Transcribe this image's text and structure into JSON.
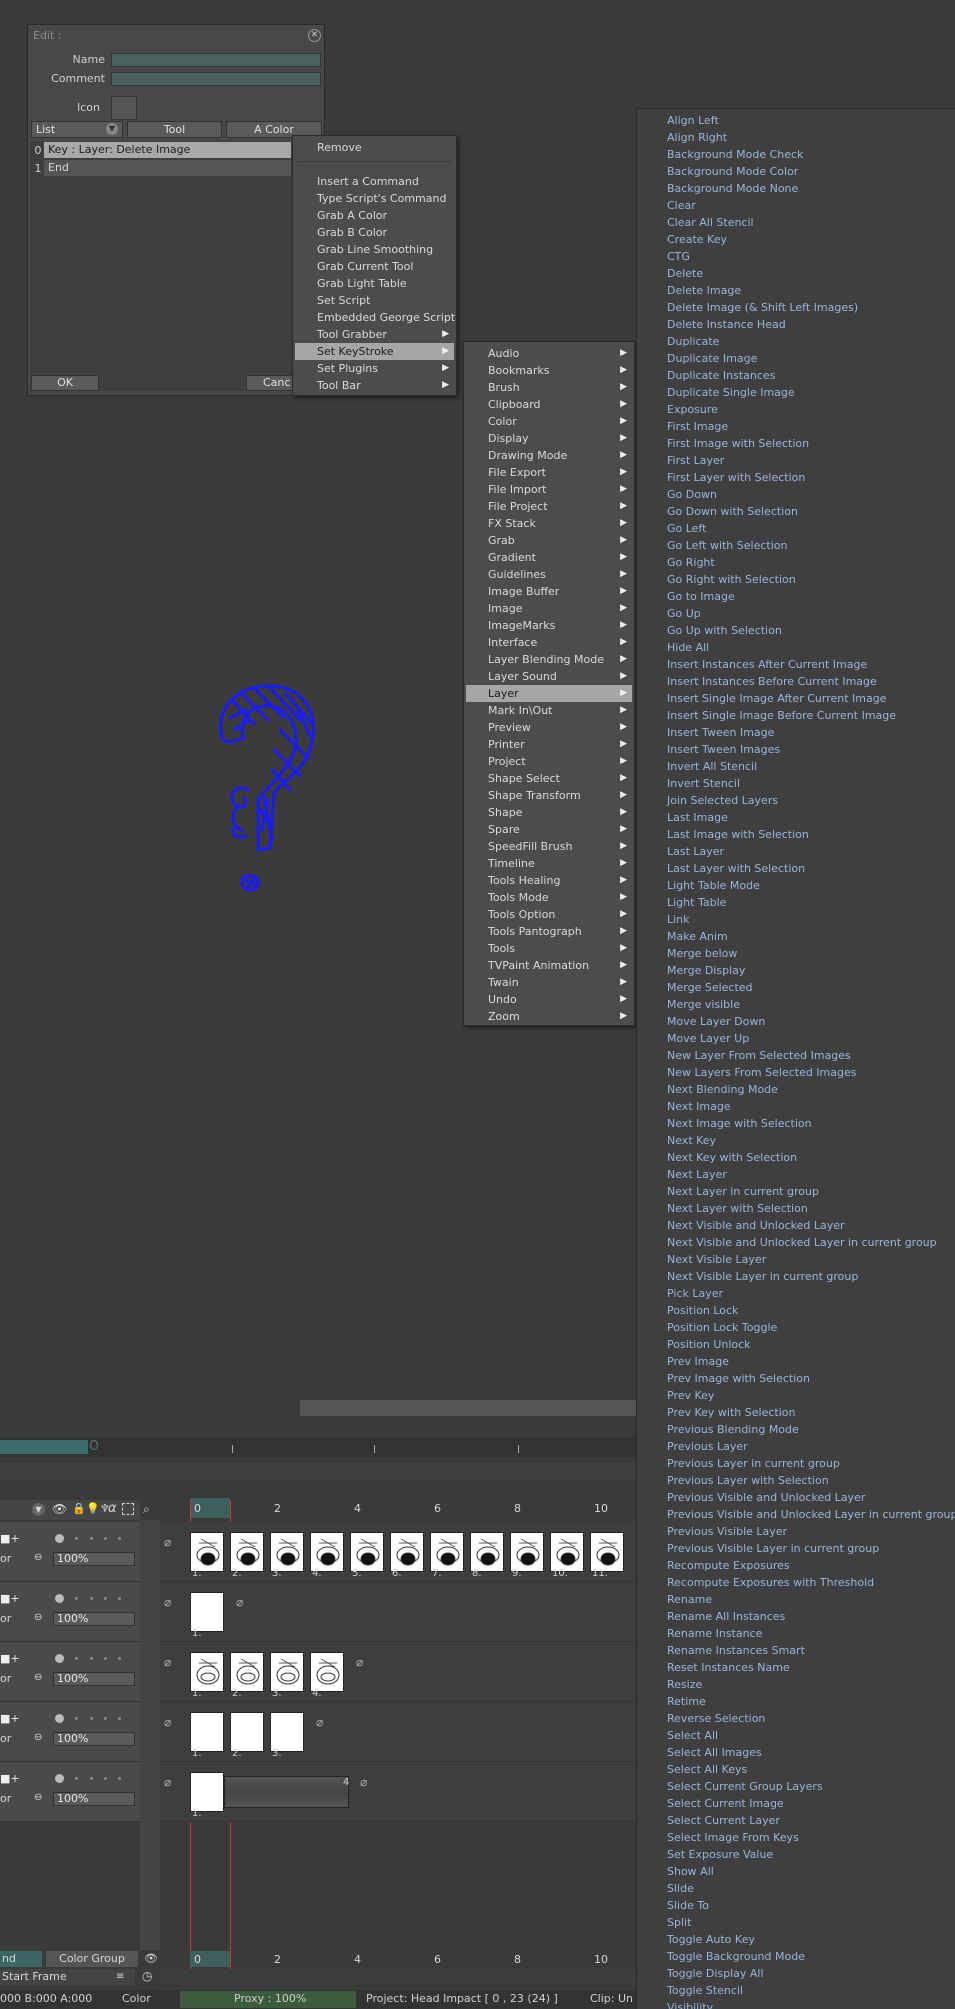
{
  "dialog": {
    "title": "Edit :",
    "name_label": "Name",
    "comment_label": "Comment",
    "icon_label": "Icon",
    "tabs": [
      "List",
      "Tool",
      "A Color"
    ],
    "list": [
      {
        "index": "0",
        "value": "Key : Layer: Delete Image"
      },
      {
        "index": "1",
        "value": "End"
      }
    ],
    "ok_label": "OK",
    "cancel_label": "Canc"
  },
  "menu1": {
    "items": [
      "Remove",
      "Insert a Command",
      "Type Script's Command",
      "Grab A Color",
      "Grab B Color",
      "Grab Line Smoothing",
      "Grab Current Tool",
      "Grab Light Table",
      "Set Script",
      "Embedded George Script",
      "Tool Grabber",
      "Set KeyStroke",
      "Set Plugins",
      "Tool Bar"
    ]
  },
  "menu2": {
    "items": [
      "Audio",
      "Bookmarks",
      "Brush",
      "Clipboard",
      "Color",
      "Display",
      "Drawing Mode",
      "File Export",
      "File Import",
      "File Project",
      "FX Stack",
      "Grab",
      "Gradient",
      "Guidelines",
      "Image Buffer",
      "Image",
      "ImageMarks",
      "Interface",
      "Layer Blending Mode",
      "Layer Sound",
      "Layer",
      "Mark In\\Out",
      "Preview",
      "Printer",
      "Project",
      "Shape Select",
      "Shape Transform",
      "Shape",
      "Spare",
      "SpeedFill Brush",
      "Timeline",
      "Tools Healing",
      "Tools Mode",
      "Tools Option",
      "Tools Pantograph",
      "Tools",
      "TVPaint Animation",
      "Twain",
      "Undo",
      "Zoom"
    ]
  },
  "menu3": {
    "items": [
      "Align Left",
      "Align Right",
      "Background Mode Check",
      "Background Mode Color",
      "Background Mode None",
      "Clear",
      "Clear All Stencil",
      "Create Key",
      "CTG",
      "Delete",
      "Delete Image",
      "Delete Image (& Shift Left Images)",
      "Delete Instance Head",
      "Duplicate",
      "Duplicate Image",
      "Duplicate Instances",
      "Duplicate Single Image",
      "Exposure",
      "First Image",
      "First Image with Selection",
      "First Layer",
      "First Layer with Selection",
      "Go Down",
      "Go Down with Selection",
      "Go Left",
      "Go Left with Selection",
      "Go Right",
      "Go Right with Selection",
      "Go to Image",
      "Go Up",
      "Go Up with Selection",
      "Hide All",
      "Insert Instances After Current Image",
      "Insert Instances Before Current Image",
      "Insert Single Image After Current Image",
      "Insert Single Image Before Current Image",
      "Insert Tween Image",
      "Insert Tween Images",
      "Invert All Stencil",
      "Invert Stencil",
      "Join Selected Layers",
      "Last Image",
      "Last Image with Selection",
      "Last Layer",
      "Last Layer with Selection",
      "Light Table Mode",
      "Light Table",
      "Link",
      "Make Anim",
      "Merge below",
      "Merge Display",
      "Merge Selected",
      "Merge visible",
      "Move Layer Down",
      "Move Layer Up",
      "New Layer From Selected Images",
      "New Layers From Selected Images",
      "Next Blending Mode",
      "Next Image",
      "Next Image with Selection",
      "Next Key",
      "Next Key with Selection",
      "Next Layer",
      "Next Layer in current group",
      "Next Layer with Selection",
      "Next Visible and Unlocked Layer",
      "Next Visible and Unlocked Layer in current group",
      "Next Visible Layer",
      "Next Visible Layer in current group",
      "Pick Layer",
      "Position Lock",
      "Position Lock Toggle",
      "Position Unlock",
      "Prev Image",
      "Prev Image with Selection",
      "Prev Key",
      "Prev Key with Selection",
      "Previous Blending Mode",
      "Previous Layer",
      "Previous Layer in current group",
      "Previous Layer with Selection",
      "Previous Visible and Unlocked Layer",
      "Previous Visible and Unlocked Layer in current group",
      "Previous Visible Layer",
      "Previous Visible Layer in current group",
      "Recompute Exposures",
      "Recompute Exposures with Threshold",
      "Rename",
      "Rename All Instances",
      "Rename Instance",
      "Rename Instances Smart",
      "Reset Instances Name",
      "Resize",
      "Retime",
      "Reverse Selection",
      "Select All",
      "Select All Images",
      "Select All Keys",
      "Select Current Group Layers",
      "Select Current Image",
      "Select Current Layer",
      "Select Image From Keys",
      "Set Exposure Value",
      "Show All",
      "Slide",
      "Slide To",
      "Split",
      "Toggle Auto Key",
      "Toggle Background Mode",
      "Toggle Display All",
      "Toggle Stencil",
      "Visibility"
    ]
  },
  "timeline": {
    "ruler": [
      "0",
      "2",
      "4",
      "6",
      "8",
      "10"
    ],
    "top_value": "000",
    "layers": [
      {
        "opacity": "100%",
        "label": "or",
        "frames": [
          "1.",
          "2.",
          "3.",
          "4.",
          "5.",
          "6.",
          "7.",
          "8.",
          "9.",
          "10.",
          "11."
        ]
      },
      {
        "opacity": "100%",
        "label": "or",
        "frames": [
          "1."
        ]
      },
      {
        "opacity": "100%",
        "label": "or",
        "frames": [
          "1.",
          "2.",
          "3.",
          "4."
        ]
      },
      {
        "opacity": "100%",
        "label": "or",
        "frames": [
          "1.",
          "2.",
          "3."
        ]
      },
      {
        "opacity": "100%",
        "label": "or",
        "frames": [
          "1."
        ],
        "hold_label": "4"
      }
    ],
    "bottom_tabs": [
      "nd",
      "Color Group"
    ],
    "start_frame_label": "Start Frame",
    "bottom_ruler": [
      "0",
      "2",
      "4",
      "6",
      "8",
      "10"
    ],
    "status": {
      "colors": "000 B:000 A:000",
      "color_label": "Color",
      "proxy": "Proxy : 100%",
      "project": "Project: Head Impact [ 0 , 23  (24) ]",
      "clip": "Clip: Un"
    }
  }
}
